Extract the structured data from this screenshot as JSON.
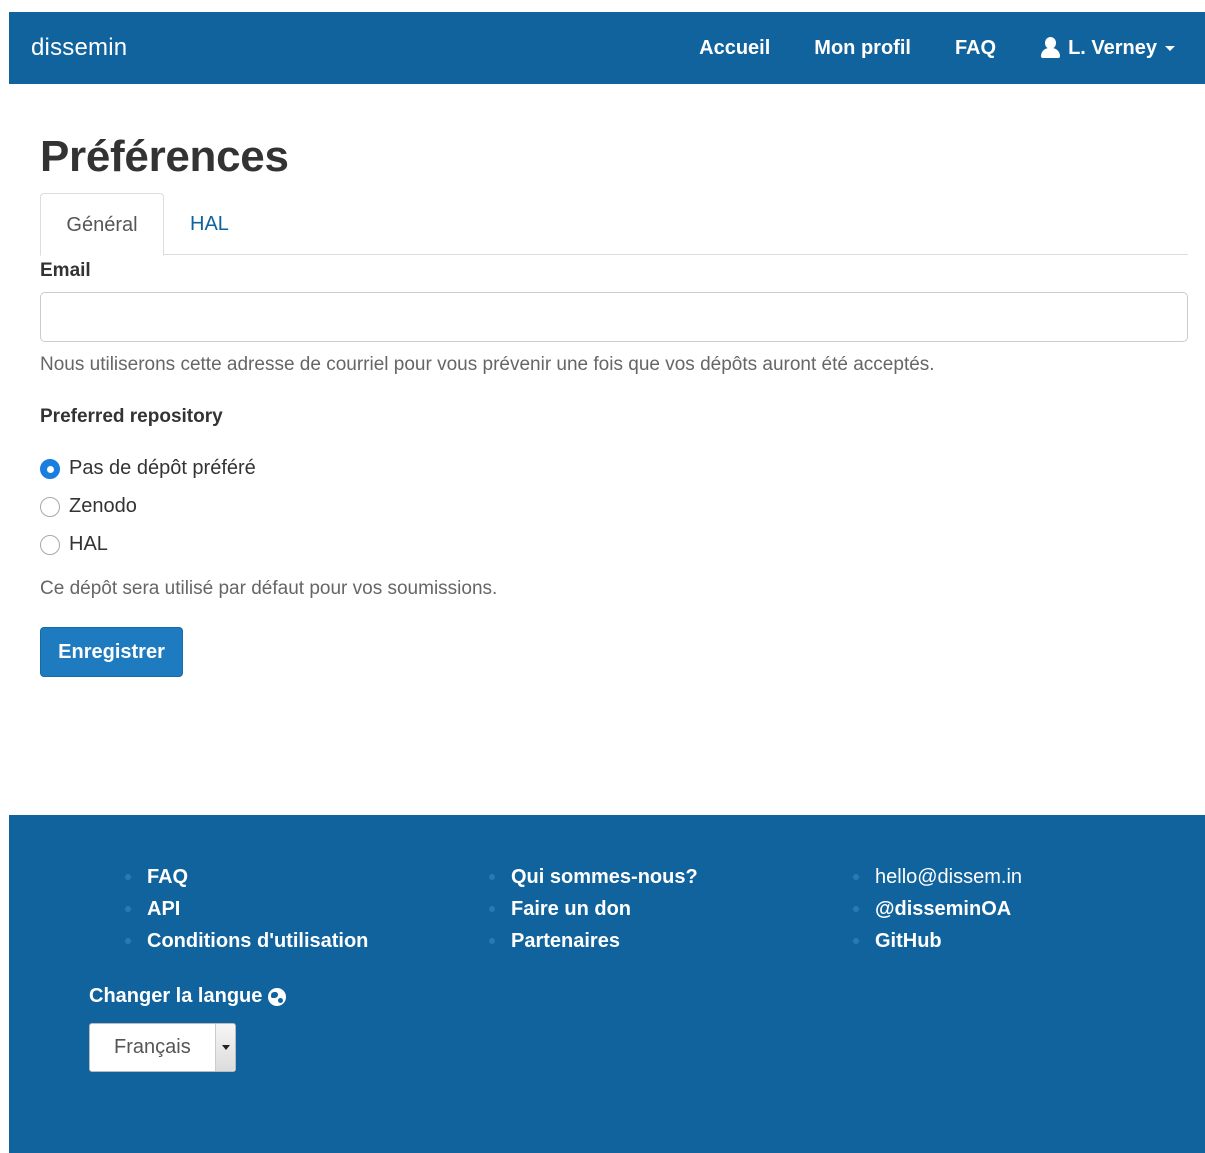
{
  "nav": {
    "brand": "dissemin",
    "links": [
      "Accueil",
      "Mon profil",
      "FAQ"
    ],
    "user": "L. Verney"
  },
  "page": {
    "title": "Préférences",
    "tabs": [
      "Général",
      "HAL"
    ]
  },
  "form": {
    "email_label": "Email",
    "email_value": "",
    "email_help": "Nous utiliserons cette adresse de courriel pour vous prévenir une fois que vos dépôts auront été acceptés.",
    "repo_label": "Preferred repository",
    "repo_options": [
      "Pas de dépôt préféré",
      "Zenodo",
      "HAL"
    ],
    "repo_selected": "Pas de dépôt préféré",
    "repo_help": "Ce dépôt sera utilisé par défaut pour vos soumissions.",
    "save_label": "Enregistrer"
  },
  "footer": {
    "col1": [
      "FAQ",
      "API",
      "Conditions d'utilisation"
    ],
    "col2": [
      "Qui sommes-nous?",
      "Faire un don",
      "Partenaires"
    ],
    "col3": [
      "hello@dissem.in",
      "@disseminOA",
      "GitHub"
    ],
    "lang_label": "Changer la langue",
    "lang_value": "Français"
  },
  "colors": {
    "primary": "#11639d",
    "button": "#1f7bc0",
    "radio_checked": "#1a7ee0"
  },
  "icons": [
    "user-icon",
    "caret-down-icon",
    "globe-icon",
    "select-arrow-icon"
  ]
}
